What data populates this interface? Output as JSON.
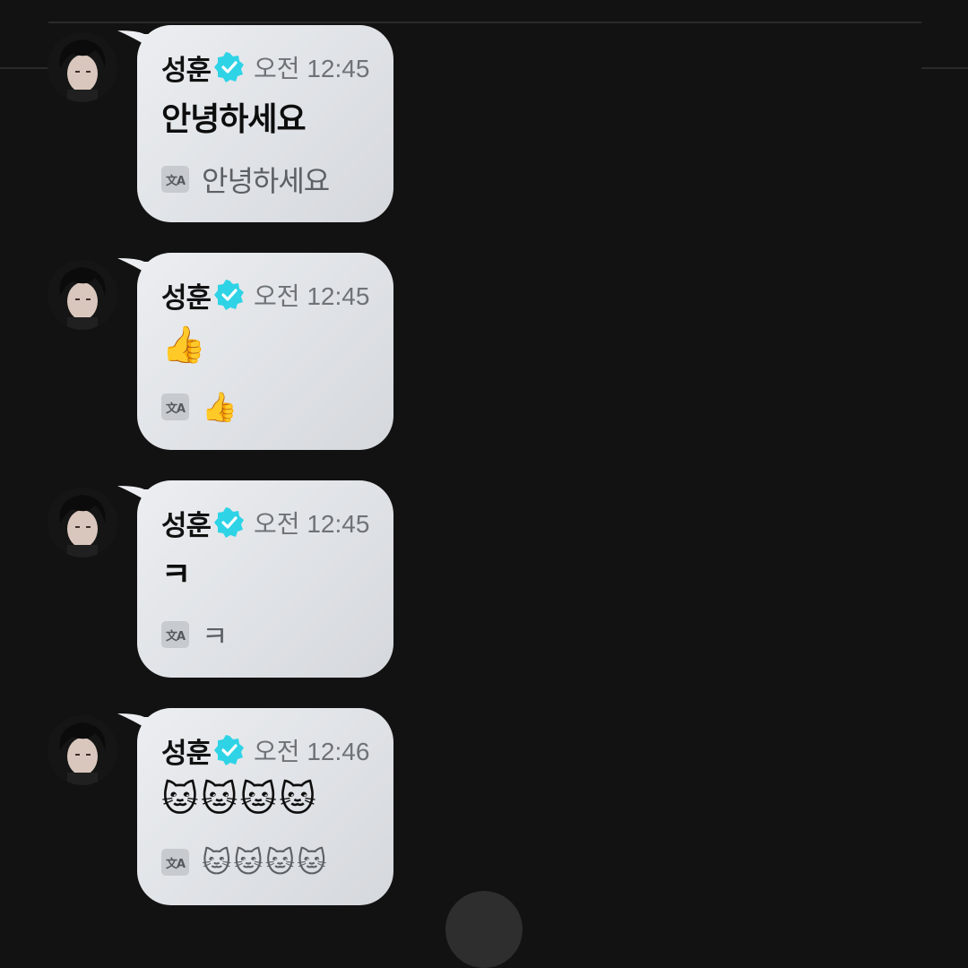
{
  "colors": {
    "background": "#121212",
    "bubble": "#e4e6e9",
    "verified": "#2fd3e6",
    "time": "#6f7378",
    "translation_text": "#5c6166"
  },
  "icons": {
    "verified": "verified-check-icon",
    "translate": "translate-icon",
    "avatar": "profile-avatar"
  },
  "translate_icon_label": "文A",
  "messages": [
    {
      "sender": "성훈",
      "time": "오전 12:45",
      "text": "안녕하세요",
      "translation": "안녕하세요"
    },
    {
      "sender": "성훈",
      "time": "오전 12:45",
      "text": "👍",
      "translation": "👍"
    },
    {
      "sender": "성훈",
      "time": "오전 12:45",
      "text": "ㅋ",
      "translation": "ㅋ"
    },
    {
      "sender": "성훈",
      "time": "오전 12:46",
      "text": "🐱🐱🐱🐱",
      "translation": "🐱🐱🐱🐱"
    }
  ]
}
